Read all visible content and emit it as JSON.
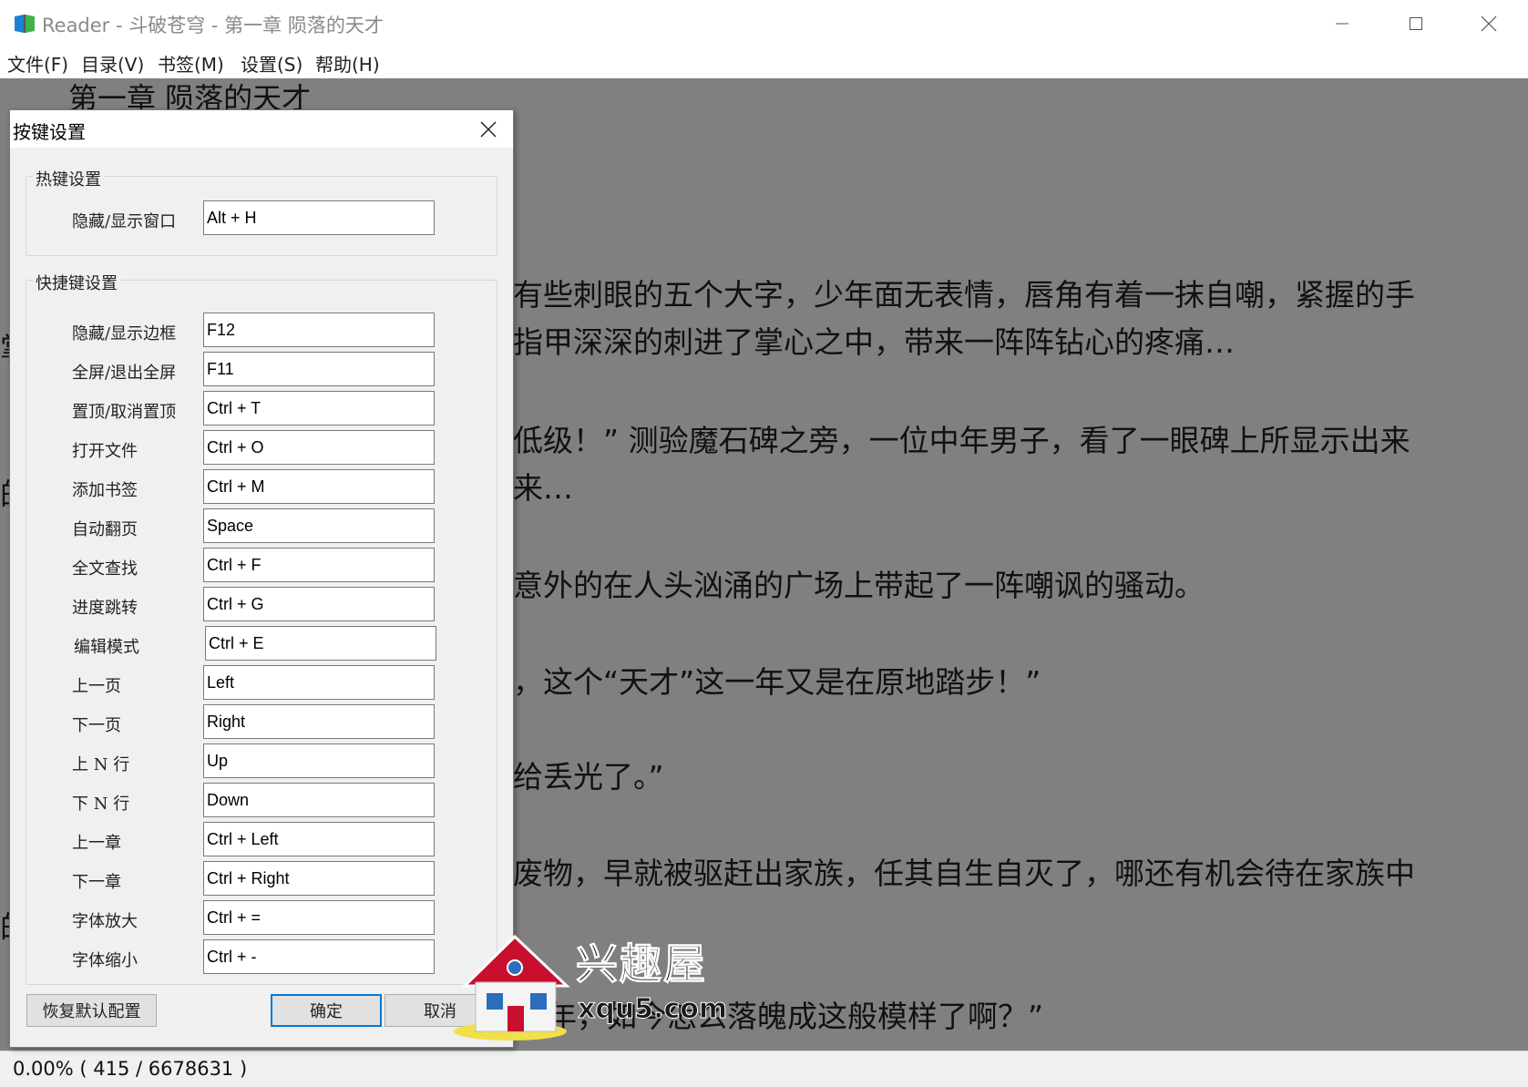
{
  "window": {
    "title": "Reader - 斗破苍穹 - 第一章 陨落的天才"
  },
  "menu": [
    {
      "label": "文件(F)"
    },
    {
      "label": "目录(V)"
    },
    {
      "label": "书签(M)"
    },
    {
      "label": "设置(S)"
    },
    {
      "label": "帮助(H)"
    }
  ],
  "reader": {
    "chapter_title": "第一章 陨落的天才",
    "lines": [
      "有些刺眼的五个大字，少年面无表情，唇角有着一抹自嘲，紧握的手",
      "指甲深深的刺进了掌心之中，带来一阵阵钻心的疼痛…",
      "低级！” 测验魔石碑之旁，一位中年男子，看了一眼碑上所显示出来",
      "来…",
      "意外的在人头汹涌的广场上带起了一阵嘲讽的骚动。",
      "，这个“天才”这一年又是在原地踏步！”",
      "给丢光了。”",
      "废物，早就被驱赶出家族，任其自生自灭了，哪还有机会待在家族中",
      "年，如今怎么落魄成这般模样了啊？”"
    ],
    "edge_chars": [
      "掌",
      "的",
      "的"
    ]
  },
  "status": {
    "progress_text": "0.00%  ( 415 / 6678631 )"
  },
  "dialog": {
    "title": "按键设置",
    "hotkey_group": {
      "label": "热键设置",
      "rows": [
        {
          "label": "隐藏/显示窗口",
          "value": "Alt + H"
        }
      ]
    },
    "shortcut_group": {
      "label": "快捷键设置",
      "rows": [
        {
          "label": "隐藏/显示边框",
          "value": "F12"
        },
        {
          "label": "全屏/退出全屏",
          "value": "F11"
        },
        {
          "label": "置顶/取消置顶",
          "value": "Ctrl + T"
        },
        {
          "label": "打开文件",
          "value": "Ctrl + O"
        },
        {
          "label": "添加书签",
          "value": "Ctrl + M"
        },
        {
          "label": "自动翻页",
          "value": "Space"
        },
        {
          "label": "全文查找",
          "value": "Ctrl + F"
        },
        {
          "label": "进度跳转",
          "value": "Ctrl + G"
        },
        {
          "label": "编辑模式",
          "value": "Ctrl + E"
        },
        {
          "label": "上一页",
          "value": "Left"
        },
        {
          "label": "下一页",
          "value": "Right"
        },
        {
          "label": "上 N 行",
          "value": "Up"
        },
        {
          "label": "下 N 行",
          "value": "Down"
        },
        {
          "label": "上一章",
          "value": "Ctrl + Left"
        },
        {
          "label": "下一章",
          "value": "Ctrl + Right"
        },
        {
          "label": "字体放大",
          "value": "Ctrl + ="
        },
        {
          "label": "字体缩小",
          "value": "Ctrl + -"
        }
      ]
    },
    "buttons": {
      "restore_defaults": "恢复默认配置",
      "ok": "确定",
      "cancel": "取消"
    }
  },
  "watermark": {
    "name": "兴趣屋",
    "url": "xqu5.com"
  },
  "colors": {
    "reader_background": "#808080",
    "dialog_background": "#f0f0f0",
    "primary_button_border": "#0078d7"
  }
}
